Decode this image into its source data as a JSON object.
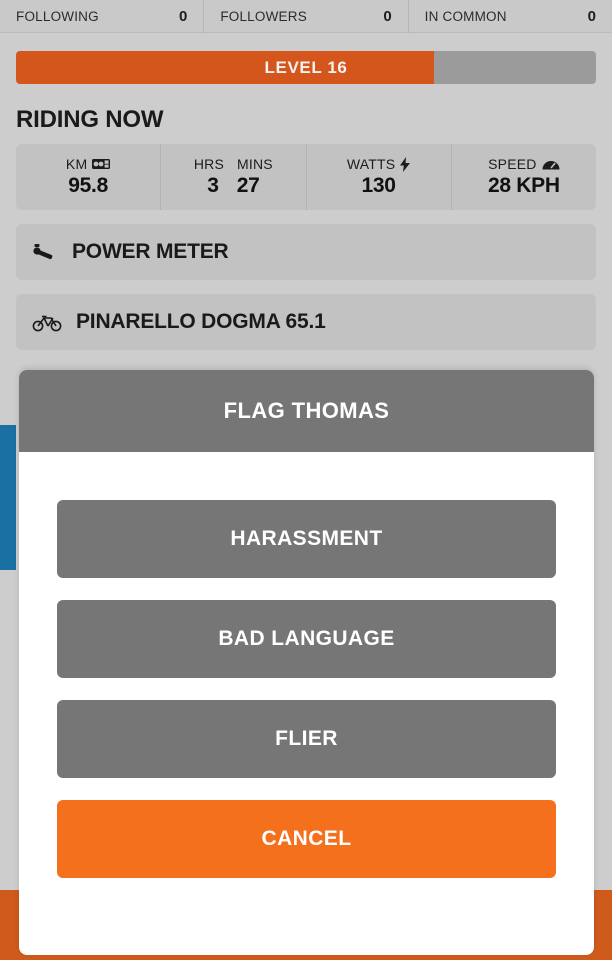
{
  "social": {
    "cells": [
      {
        "label": "FOLLOWING",
        "value": "0"
      },
      {
        "label": "FOLLOWERS",
        "value": "0"
      },
      {
        "label": "IN COMMON",
        "value": "0"
      }
    ]
  },
  "level": {
    "text": "LEVEL 16",
    "fill_percent": 72,
    "fill_color": "#d4561c",
    "track_color": "#9b9b9b"
  },
  "riding": {
    "title": "RIDING NOW",
    "stats": [
      {
        "label": "KM",
        "icon": "odometer-icon",
        "value": "95.8"
      },
      {
        "label_hrs": "HRS",
        "label_mins": "MINS",
        "value_hrs": "3",
        "value_mins": "27"
      },
      {
        "label": "WATTS",
        "icon": "lightning-bolt-icon",
        "value": "130"
      },
      {
        "label": "SPEED",
        "icon": "speedometer-icon",
        "value": "28 KPH"
      }
    ]
  },
  "equipment": [
    {
      "label": "POWER METER",
      "icon": "crank-arm-icon"
    },
    {
      "label": "PINARELLO DOGMA 65.1",
      "icon": "bicycle-icon"
    }
  ],
  "modal": {
    "title": "FLAG THOMAS",
    "options": [
      {
        "label": "HARASSMENT"
      },
      {
        "label": "BAD LANGUAGE"
      },
      {
        "label": "FLIER"
      }
    ],
    "cancel_label": "CANCEL",
    "cancel_color": "#f4701c",
    "header_color": "#767676"
  }
}
